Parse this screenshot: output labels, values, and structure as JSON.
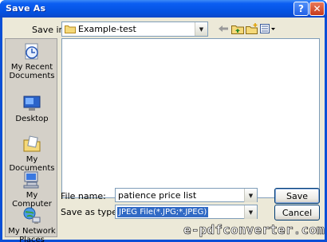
{
  "window": {
    "title": "Save As",
    "help_label": "?",
    "close_label": "✕"
  },
  "toolbar": {
    "save_in_label": "Save in:",
    "folder": "Example-test",
    "icons": [
      "back-arrow-icon",
      "up-folder-icon",
      "new-folder-icon",
      "views-menu-icon"
    ]
  },
  "places": [
    {
      "id": "recent",
      "label_1": "My Recent",
      "label_2": "Documents",
      "icon": "recent-documents-icon"
    },
    {
      "id": "desktop",
      "label_1": "Desktop",
      "label_2": "",
      "icon": "desktop-icon"
    },
    {
      "id": "documents",
      "label_1": "My Documents",
      "label_2": "",
      "icon": "my-documents-icon"
    },
    {
      "id": "computer",
      "label_1": "My Computer",
      "label_2": "",
      "icon": "my-computer-icon"
    },
    {
      "id": "network",
      "label_1": "My Network",
      "label_2": "Places",
      "icon": "network-places-icon"
    }
  ],
  "form": {
    "file_name_label": "File name:",
    "file_name_value": "patience price list",
    "save_type_label": "Save as type:",
    "save_type_value": "JPEG File(*.JPG;*.JPEG)"
  },
  "buttons": {
    "save": "Save",
    "cancel": "Cancel"
  },
  "watermark": "e-pdfconverter.com",
  "colors": {
    "title_bar": "#0451e0",
    "dialog_bg": "#ece9d8",
    "selection": "#316ac5"
  }
}
